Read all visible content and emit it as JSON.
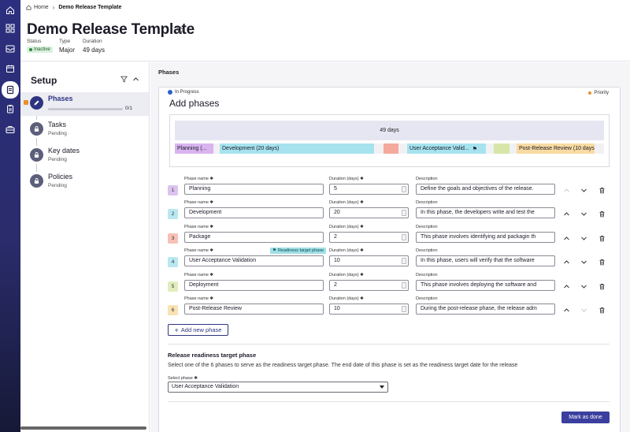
{
  "breadcrumb": {
    "home": "Home",
    "current": "Demo Release Template"
  },
  "header": {
    "title": "Demo Release Template",
    "status_label": "Status",
    "status_value": "Inactive",
    "type_label": "Type",
    "type_value": "Major",
    "duration_label": "Duration",
    "duration_value": "49 days"
  },
  "sidebar": {
    "title": "Setup",
    "steps": [
      {
        "label": "Phases",
        "progress": "0/1",
        "progress_fraction": 0
      },
      {
        "label": "Tasks",
        "status": "Pending"
      },
      {
        "label": "Key dates",
        "status": "Pending"
      },
      {
        "label": "Policies",
        "status": "Pending"
      }
    ]
  },
  "main": {
    "heading": "Phases",
    "status_chip": "In Progress",
    "priority": "Priority",
    "card_title": "Add phases",
    "timeline": {
      "total": "49 days",
      "bars": [
        {
          "label": "Planning (...",
          "color": "#d9b4ef"
        },
        {
          "label": "Development (20 days)",
          "color": "#a6e3ee"
        },
        {
          "label": "",
          "color": "#f3aa9c"
        },
        {
          "label": "User Acceptance Valid...",
          "color": "#a6e3ee"
        },
        {
          "label": "",
          "color": "#d7e6a8"
        },
        {
          "label": "Post-Release Review (10 days)",
          "color": "#f8dba2"
        }
      ]
    },
    "field_labels": {
      "name": "Phase name",
      "duration": "Duration (days)",
      "description": "Description"
    },
    "readiness_tag": "Readiness target phase",
    "phases": [
      {
        "num": "1",
        "name": "Planning",
        "duration": "5",
        "description": "Define the goals and objectives of the release.",
        "color": "#dcc3ef"
      },
      {
        "num": "2",
        "name": "Development",
        "duration": "20",
        "description": "In this phase, the developers write and test the",
        "color": "#b9e8f0"
      },
      {
        "num": "3",
        "name": "Package",
        "duration": "2",
        "description": "This phase involves identifying and packagin th",
        "color": "#f6c1b6"
      },
      {
        "num": "4",
        "name": "User Acceptance Validation",
        "duration": "10",
        "description": "In this phase, users will verify that the software",
        "color": "#b9e8f0"
      },
      {
        "num": "5",
        "name": "Deployment",
        "duration": "2",
        "description": "This phase involves deploying the software and",
        "color": "#e2edbe"
      },
      {
        "num": "6",
        "name": "Post-Release Review",
        "duration": "10",
        "description": "During the post-release phase, the release adm",
        "color": "#f9e2b3"
      }
    ],
    "add_phase": "Add new phase",
    "readiness": {
      "title": "Release readiness target phase",
      "description": "Select one of the 6 phases to serve as the readiness target phase. The end date of this phase is set as the readiness target date for the release",
      "select_label": "Select phase",
      "selected": "User Acceptance Validation"
    },
    "done_button": "Mark as done"
  }
}
